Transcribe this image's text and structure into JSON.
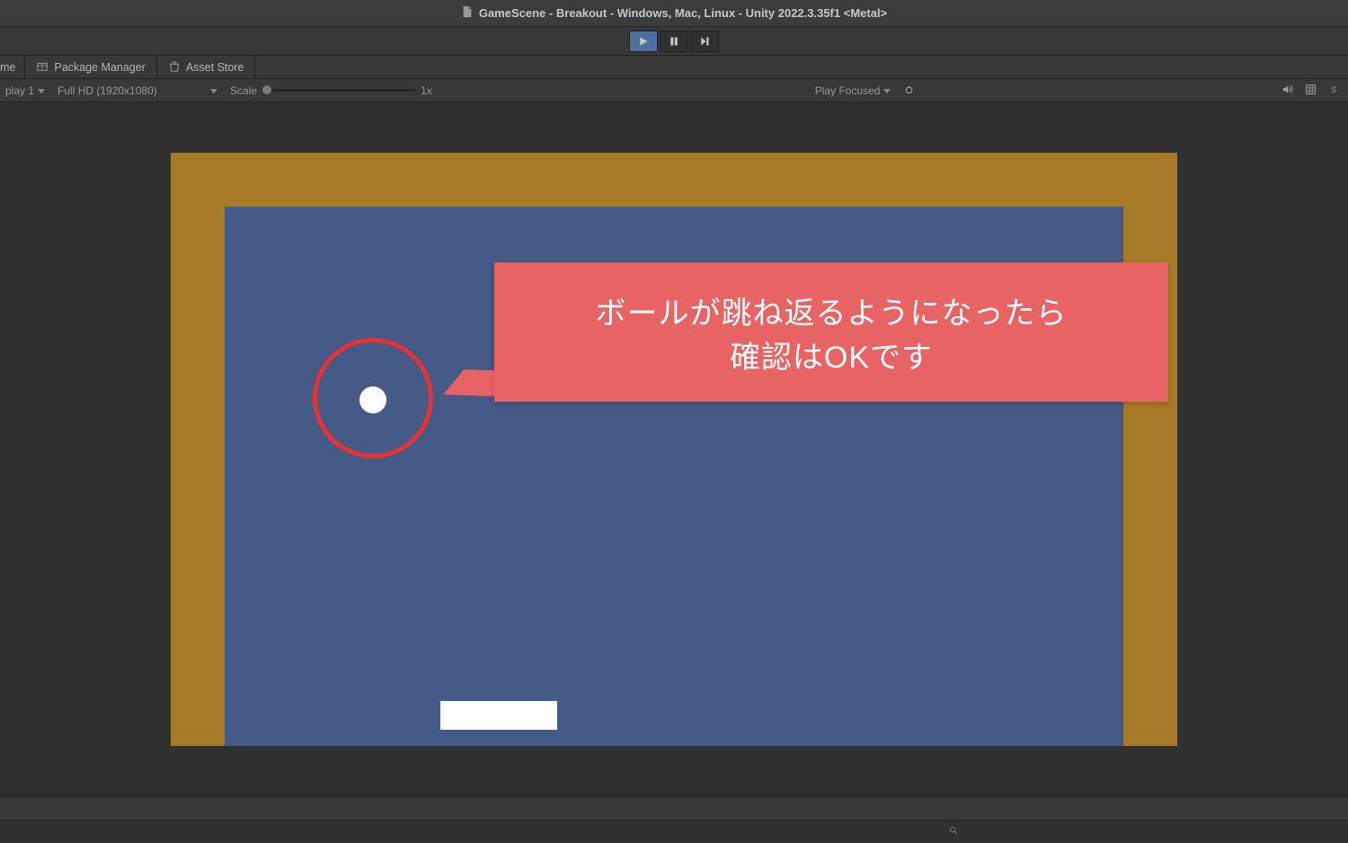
{
  "window": {
    "title": "GameScene - Breakout - Windows, Mac, Linux - Unity 2022.3.35f1 <Metal>"
  },
  "playbar": {
    "playing": true
  },
  "tabs": {
    "game": "me",
    "package_manager": "Package Manager",
    "asset_store": "Asset Store"
  },
  "toolbar": {
    "display_dd": "play 1",
    "resolution_dd": "Full HD (1920x1080)",
    "scale_label": "Scale",
    "scale_value": "1x",
    "focus_dd": "Play Focused",
    "right_icons": [
      "bug-icon",
      "audio-icon",
      "grid-icon",
      "stats-icon"
    ]
  },
  "annotation": {
    "line1": "ボールが跳ね返るようになったら",
    "line2": "確認はOKです"
  },
  "colors": {
    "wall": "#a77a27",
    "field": "#455a87",
    "callout": "#e86464",
    "circle": "#e63232"
  },
  "search": {
    "placeholder": ""
  }
}
